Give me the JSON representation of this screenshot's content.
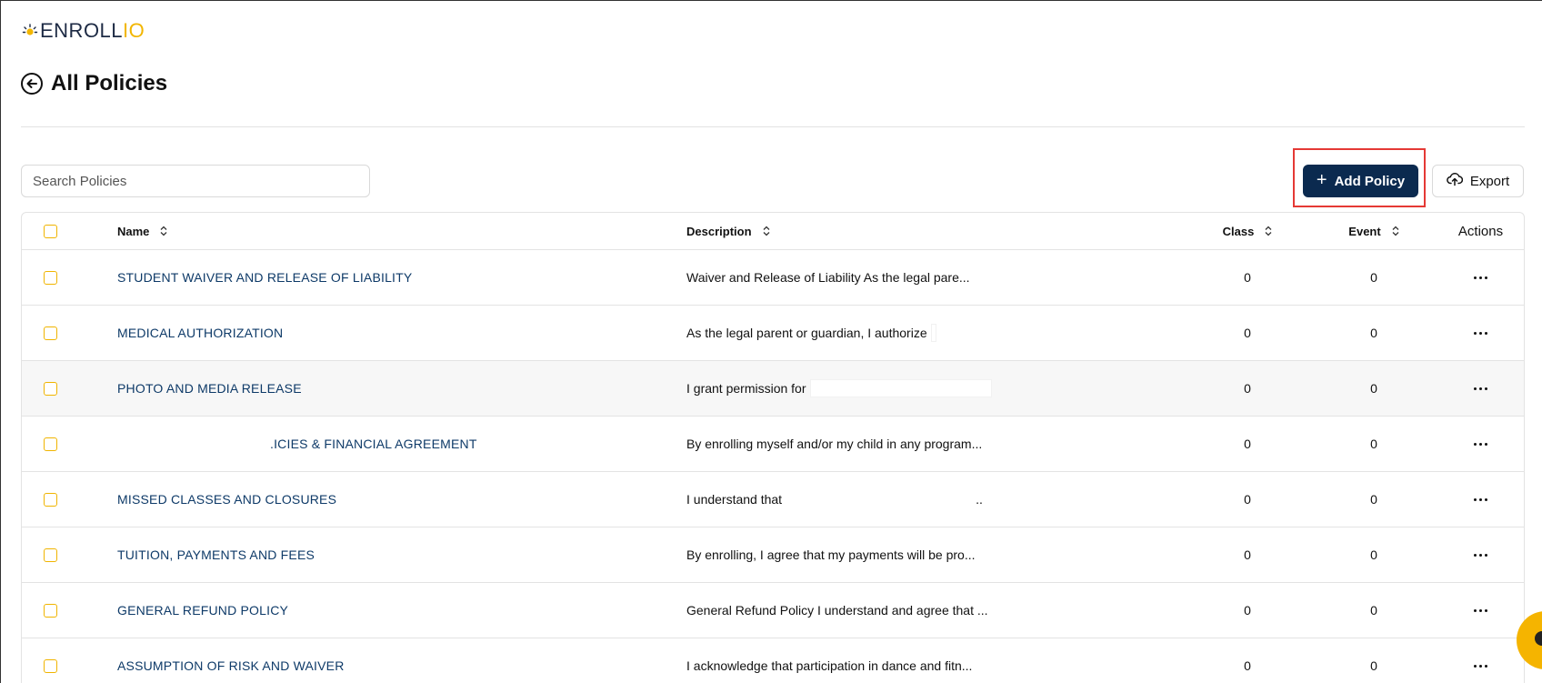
{
  "brand": {
    "prefix": "ENROLL",
    "suffix": "IO"
  },
  "page": {
    "title": "All Policies"
  },
  "search": {
    "placeholder": "Search Policies"
  },
  "toolbar": {
    "add_label": "Add Policy",
    "export_label": "Export"
  },
  "table": {
    "headers": {
      "name": "Name",
      "description": "Description",
      "class": "Class",
      "event": "Event",
      "actions": "Actions"
    },
    "rows": [
      {
        "name": "STUDENT WAIVER AND RELEASE OF LIABILITY",
        "description": "Waiver and Release of Liability As the legal pare...",
        "class": "0",
        "event": "0"
      },
      {
        "name": "MEDICAL AUTHORIZATION",
        "description": "As the legal parent or guardian, I authorize",
        "class": "0",
        "event": "0"
      },
      {
        "name": "PHOTO AND MEDIA RELEASE",
        "description": "I grant permission for",
        "class": "0",
        "event": "0"
      },
      {
        "name": ".ICIES & FINANCIAL AGREEMENT",
        "description": "By enrolling myself and/or my child in any program...",
        "class": "0",
        "event": "0"
      },
      {
        "name": "MISSED CLASSES AND CLOSURES",
        "description": "I understand that",
        "description_tail": "..",
        "class": "0",
        "event": "0"
      },
      {
        "name": "TUITION, PAYMENTS AND FEES",
        "description": "By enrolling, I agree that my payments will be pro...",
        "class": "0",
        "event": "0"
      },
      {
        "name": "GENERAL REFUND POLICY",
        "description": "General Refund Policy I understand and agree that ...",
        "class": "0",
        "event": "0"
      },
      {
        "name": "ASSUMPTION OF RISK AND WAIVER",
        "description": "I acknowledge that participation in dance and fitn...",
        "class": "0",
        "event": "0"
      }
    ]
  },
  "colors": {
    "primary": "#0b2a4f",
    "accent": "#f2b600",
    "link": "#0e3a68",
    "highlight": "#e53935"
  },
  "icons": [
    "sun-logo-icon",
    "back-arrow-icon",
    "plus-icon",
    "cloud-upload-icon",
    "sort-icon",
    "more-icon",
    "chat-icon"
  ]
}
